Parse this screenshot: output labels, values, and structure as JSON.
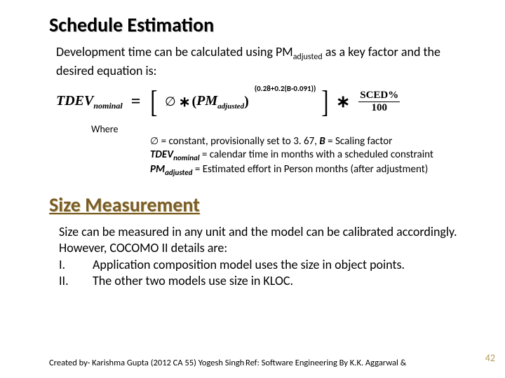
{
  "title1": "Schedule Estimation",
  "lead": {
    "pre": "Development time can be calculated using PM",
    "sub": "adjusted",
    "post": " as a key factor and the desired equation is:"
  },
  "formula": {
    "tdev": "TDEV",
    "tdev_sub": "nominal",
    "phi": "∅",
    "pm": "PM",
    "pm_sub": "adjusted",
    "exponent": "(0.28+0.2(B-0.091))",
    "sced_num": "SCED%",
    "sced_den": "100"
  },
  "where": {
    "label": "Where",
    "line1_phi": "∅",
    "line1_rest": " = constant, provisionally set to 3. 67, ",
    "line1_B": "B",
    "line1_B_rest": " = Scaling factor",
    "line2_tdev": "TDEV",
    "line2_tdev_sub": "nominal",
    "line2_rest": " = calendar time in months with a scheduled constraint",
    "line3_pm": "PM",
    "line3_pm_sub": "adjusted",
    "line3_rest": " = Estimated effort in Person months (after adjustment)"
  },
  "title2": "Size Measurement",
  "body2": {
    "p1": "Size can be measured in any unit and the model can be calibrated accordingly. However, COCOMO II details are:",
    "i1_num": "I.",
    "i1": "Application composition model uses the size in object points.",
    "i2_num": "II.",
    "i2": "The other two models use size in KLOC."
  },
  "footer": {
    "created": "Created by- Karishma Gupta (2012 CA 55) Yogesh Singh",
    "ref": "Ref: Software Engineering By K.K. Aggarwal &"
  },
  "page": "42"
}
